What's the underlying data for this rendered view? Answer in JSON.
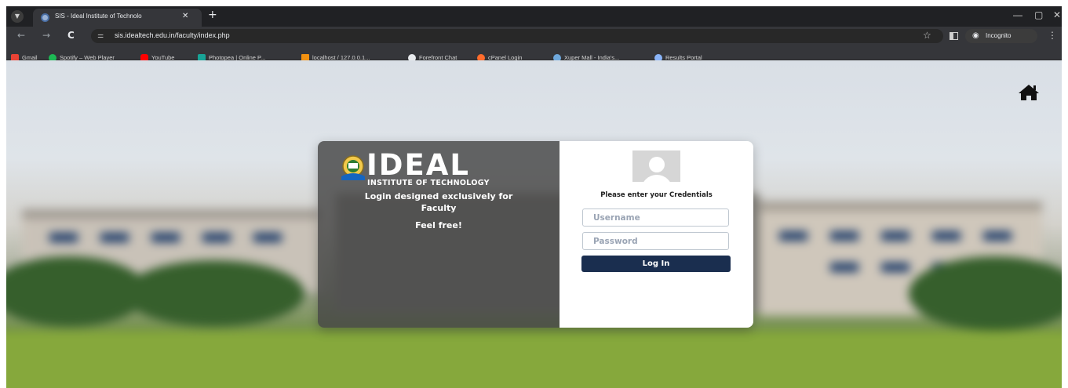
{
  "browser": {
    "tab": {
      "title": "SIS - Ideal Institute of Technolo",
      "close": "✕"
    },
    "new_tab": "+",
    "window_controls": {
      "minimize": "—",
      "restore": "▢",
      "close": "✕"
    },
    "nav": {
      "back": "←",
      "forward": "→",
      "reload": "C"
    },
    "url": "sis.idealtech.edu.in/faculty/index.php",
    "incognito_label": "Incognito",
    "menu": "⋮",
    "bookmarks": [
      {
        "label": "Gmail",
        "color": "#ea4335"
      },
      {
        "label": "Spotify – Web Player",
        "color": "#1db954"
      },
      {
        "label": "YouTube",
        "color": "#ff0000"
      },
      {
        "label": "Photopea | Online P...",
        "color": "#18a497"
      },
      {
        "label": "localhost / 127.0.0.1...",
        "color": "#f29111"
      },
      {
        "label": "Forefront Chat",
        "color": "#e8eaed"
      },
      {
        "label": "cPanel Login",
        "color": "#ff6c2c"
      },
      {
        "label": "Xuper Mall - India's...",
        "color": "#6fa8dc"
      },
      {
        "label": "Results Portal",
        "color": "#8ab4f8"
      }
    ]
  },
  "login": {
    "logo_word": "IDEAL",
    "logo_sub": "INSTITUTE OF TECHNOLOGY",
    "intro_line1": "Login designed exclusively for",
    "intro_line2": "Faculty",
    "feel_free": "Feel free!",
    "credentials_label": "Please enter your Credentials",
    "username_placeholder": "Username",
    "password_placeholder": "Password",
    "login_button": "Log In"
  },
  "colors": {
    "button_bg": "#1a2e4f",
    "panel_left": "#464646",
    "chrome_dark": "#202124",
    "chrome_toolbar": "#35363a"
  }
}
